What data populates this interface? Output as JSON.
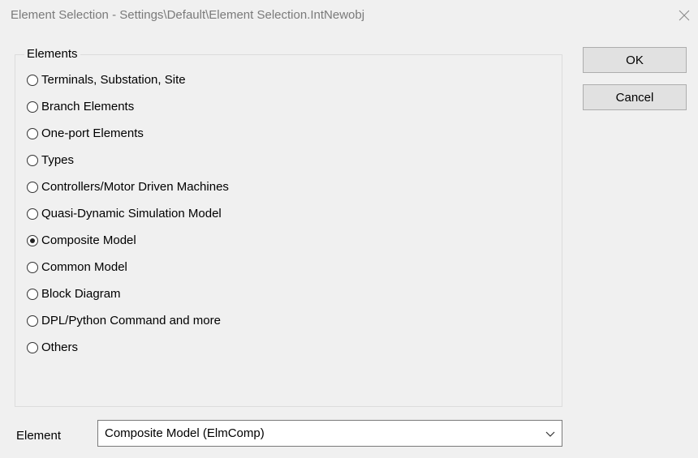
{
  "window": {
    "title": "Element Selection - Settings\\Default\\Element Selection.IntNewobj",
    "close_icon": "close-icon"
  },
  "elements_group": {
    "legend": "Elements",
    "options": [
      {
        "label": "Terminals, Substation, Site",
        "checked": false
      },
      {
        "label": "Branch Elements",
        "checked": false
      },
      {
        "label": "One-port Elements",
        "checked": false
      },
      {
        "label": "Types",
        "checked": false
      },
      {
        "label": "Controllers/Motor Driven Machines",
        "checked": false
      },
      {
        "label": "Quasi-Dynamic Simulation Model",
        "checked": false
      },
      {
        "label": "Composite Model",
        "checked": true
      },
      {
        "label": "Common Model",
        "checked": false
      },
      {
        "label": "Block Diagram",
        "checked": false
      },
      {
        "label": "DPL/Python Command and more",
        "checked": false
      },
      {
        "label": "Others",
        "checked": false
      }
    ]
  },
  "buttons": {
    "ok_label": "OK",
    "cancel_label": "Cancel"
  },
  "element_field": {
    "label": "Element",
    "selected_value": "Composite Model (ElmComp)",
    "dropdown_icon": "chevron-down-icon"
  }
}
